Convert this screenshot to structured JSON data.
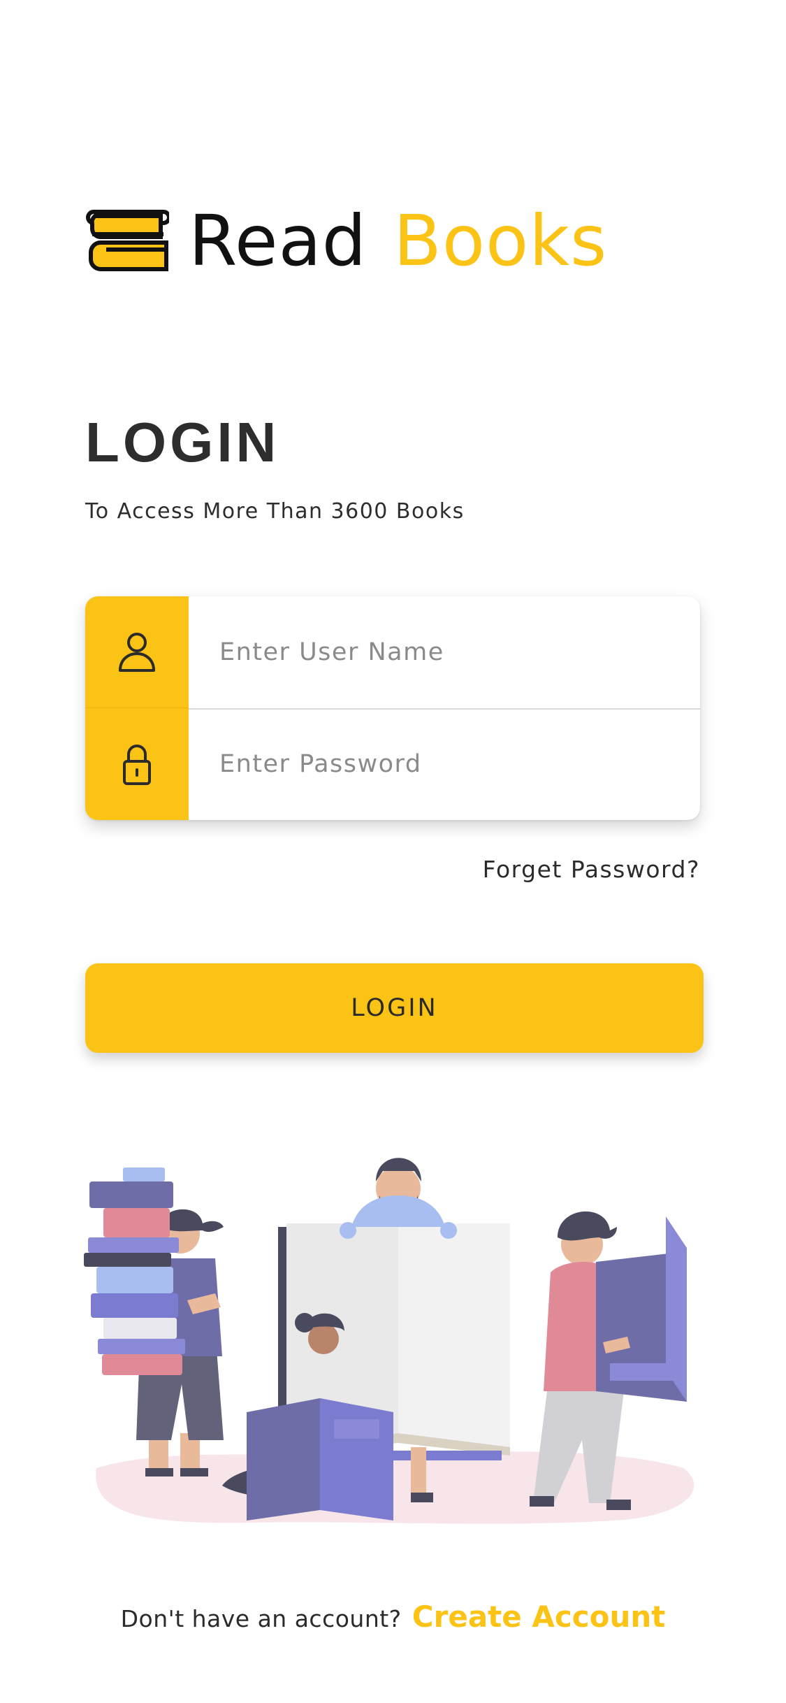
{
  "brand": {
    "word_dark": "Read",
    "word_accent": "Books",
    "logo_icon": "stacked-books-icon"
  },
  "login": {
    "title": "LOGIN",
    "subtitle": "To Access More Than 3600 Books"
  },
  "form": {
    "username": {
      "icon": "user-icon",
      "placeholder": "Enter User Name",
      "value": ""
    },
    "password": {
      "icon": "lock-icon",
      "placeholder": "Enter Password",
      "value": ""
    },
    "forgot_label": "Forget Password?",
    "submit_label": "LOGIN"
  },
  "footer": {
    "prompt": "Don't have an account?",
    "link_label": "Create Account"
  },
  "colors": {
    "accent": "#fcc317",
    "text": "#2b2b2b",
    "illustration_purple": "#6f6da8",
    "illustration_pink": "#e08a97",
    "illustration_ground": "#f7e5ea"
  }
}
